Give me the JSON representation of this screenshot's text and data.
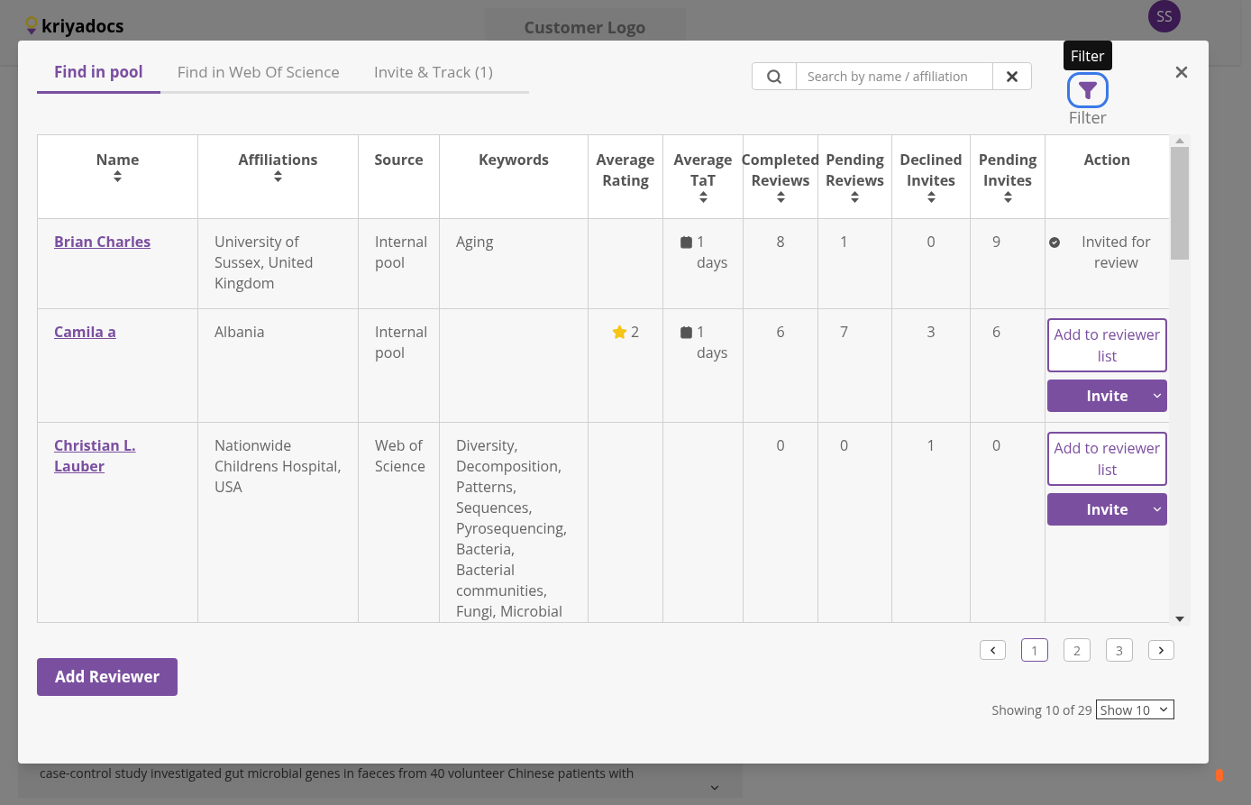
{
  "background": {
    "logo": "kriyadocs",
    "customer_logo": "Customer Logo",
    "avatar": "SS",
    "abstract_line": "case-control study investigated gut microbial genes in faeces from 40 volunteer Chinese patients with"
  },
  "tabs": [
    {
      "label": "Find in pool",
      "selected": true
    },
    {
      "label": "Find in Web Of Science",
      "selected": false
    },
    {
      "label": "Invite & Track (1)",
      "selected": false
    }
  ],
  "search": {
    "placeholder": "Search by name / affiliation"
  },
  "filter": {
    "tooltip": "Filter",
    "label": "Filter",
    "focused": true
  },
  "table": {
    "columns": [
      {
        "label": "Name",
        "sortable": true
      },
      {
        "label": "Affiliations",
        "sortable": true
      },
      {
        "label": "Source",
        "sortable": false
      },
      {
        "label": "Keywords",
        "sortable": false
      },
      {
        "label": "Average Rating",
        "sortable": false
      },
      {
        "label": "Average TaT",
        "sortable": true
      },
      {
        "label": "Completed Reviews",
        "sortable": true
      },
      {
        "label": "Pending Reviews",
        "sortable": true
      },
      {
        "label": "Declined Invites",
        "sortable": true
      },
      {
        "label": "Pending Invites",
        "sortable": true
      },
      {
        "label": "Action",
        "sortable": false
      }
    ],
    "rows": [
      {
        "name": "Brian Charles",
        "affiliation": "University of Sussex, United Kingdom",
        "source": "Internal pool",
        "keywords": "Aging",
        "tat": "1 days",
        "completed": "8",
        "pending_reviews": "1",
        "declined": "0",
        "pending_invites": "9",
        "action": {
          "kind": "invited",
          "text": "Invited for review"
        }
      },
      {
        "name": "Camila a",
        "affiliation": "Albania",
        "source": "Internal pool",
        "rating": "2",
        "tat": "1 days",
        "completed": "6",
        "pending_reviews": "7",
        "declined": "3",
        "pending_invites": "6",
        "action": {
          "kind": "buttons",
          "add": "Add to reviewer list",
          "invite": "Invite"
        }
      },
      {
        "name": "Christian L. Lauber",
        "affiliation": "Nationwide Childrens Hospital, USA",
        "source": "Web of Science",
        "keywords": "Diversity, Decomposition, Patterns, Sequences, Pyrosequencing, Bacteria, Bacterial communities, Fungi, Microbial",
        "completed": "0",
        "pending_reviews": "0",
        "declined": "1",
        "pending_invites": "0",
        "action": {
          "kind": "buttons",
          "add": "Add to reviewer list",
          "invite": "Invite"
        }
      }
    ]
  },
  "pagination": [
    {
      "label": "1",
      "selected": true
    },
    {
      "label": "2",
      "selected": false
    },
    {
      "label": "3",
      "selected": false
    }
  ],
  "add_reviewer": "Add Reviewer",
  "showing": "Showing 10 of 29",
  "page_size": "Show 10"
}
